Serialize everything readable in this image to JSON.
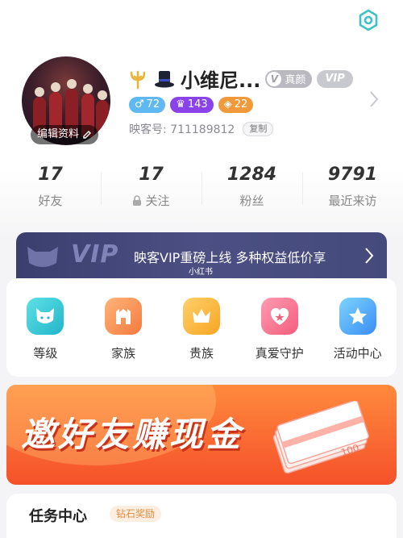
{
  "profile": {
    "name": "小维尼...",
    "real_badge": "真颜",
    "vip_badge": "VIP",
    "edit_label": "编辑资料",
    "gender_count": "72",
    "crown_count": "143",
    "level_count": "22",
    "id_label": "映客号: 711189812",
    "copy_label": "复制"
  },
  "stats": [
    {
      "num": "17",
      "label": "好友"
    },
    {
      "num": "17",
      "label": "关注"
    },
    {
      "num": "1284",
      "label": "粉丝"
    },
    {
      "num": "9791",
      "label": "最近来访"
    }
  ],
  "vip_banner": {
    "vip_text": "VIP",
    "message": "映客VIP重磅上线 多种权益低价享"
  },
  "watermark": "小红书",
  "features": [
    {
      "label": "等级"
    },
    {
      "label": "家族"
    },
    {
      "label": "贵族"
    },
    {
      "label": "真爱守护"
    },
    {
      "label": "活动中心"
    }
  ],
  "invite": {
    "title": "邀好友赚现金",
    "money_label": "100"
  },
  "tasks": {
    "title": "任务中心",
    "pill": "钻石奖励"
  },
  "colors": {
    "vip_banner": "#454a7c",
    "invite_banner": "#f5512a",
    "gender_tag": "#5fb8f2",
    "crown_tag": "#8a43e8",
    "level_tag": "#f29a3b"
  }
}
